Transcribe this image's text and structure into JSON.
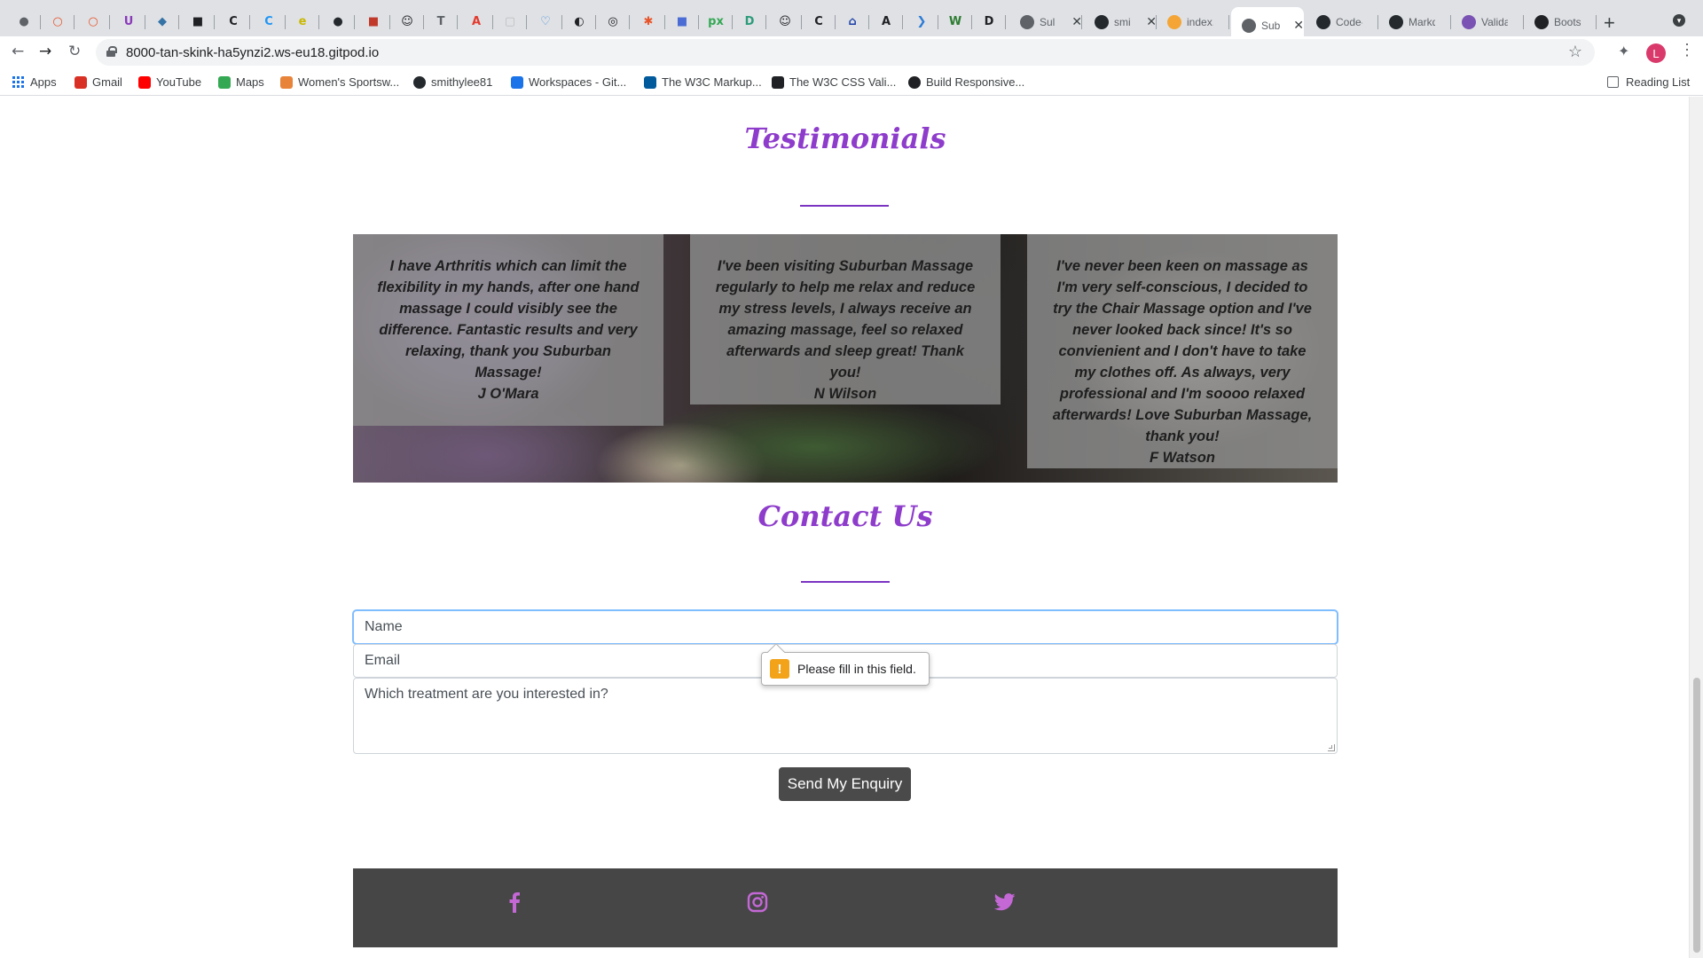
{
  "browser": {
    "tabs_small": [
      {
        "icon": "bulb-icon",
        "glyph": "●",
        "color": "#5f6368"
      },
      {
        "icon": "ring-icon",
        "glyph": "○",
        "color": "#e8542a"
      },
      {
        "icon": "ring-icon",
        "glyph": "○",
        "color": "#e8542a"
      },
      {
        "icon": "u-icon",
        "glyph": "U",
        "color": "#8a3ab9"
      },
      {
        "icon": "python-icon",
        "glyph": "◆",
        "color": "#3572a5"
      },
      {
        "icon": "bucket-icon",
        "glyph": "■",
        "color": "#202124"
      },
      {
        "icon": "c-black-icon",
        "glyph": "C",
        "color": "#202124"
      },
      {
        "icon": "c-blue-icon",
        "glyph": "C",
        "color": "#2196f3"
      },
      {
        "icon": "e-icon",
        "glyph": "e",
        "color": "#c9b800"
      },
      {
        "icon": "github-icon",
        "glyph": "●",
        "color": "#24292e"
      },
      {
        "icon": "red-square-icon",
        "glyph": "■",
        "color": "#c0392b"
      },
      {
        "icon": "face-icon",
        "glyph": "☺",
        "color": "#202124"
      },
      {
        "icon": "t-icon",
        "glyph": "T",
        "color": "#5f6368"
      },
      {
        "icon": "acrobat-icon",
        "glyph": "A",
        "color": "#e23a2e"
      },
      {
        "icon": "grey-icon",
        "glyph": "▢",
        "color": "#bdbdbd"
      },
      {
        "icon": "heart-icon",
        "glyph": "♡",
        "color": "#4a90d9"
      },
      {
        "icon": "globe-icon",
        "glyph": "◐",
        "color": "#202124"
      },
      {
        "icon": "target-icon",
        "glyph": "◎",
        "color": "#202124"
      },
      {
        "icon": "asterisk-icon",
        "glyph": "✱",
        "color": "#e8542a"
      },
      {
        "icon": "blocks-icon",
        "glyph": "■",
        "color": "#4a6cd4"
      },
      {
        "icon": "px-icon",
        "glyph": "px",
        "color": "#34a853"
      },
      {
        "icon": "d-icon",
        "glyph": "D",
        "color": "#2d9c7a"
      },
      {
        "icon": "smile-icon",
        "glyph": "☺",
        "color": "#202124"
      },
      {
        "icon": "c-dark-icon",
        "glyph": "C",
        "color": "#202124"
      },
      {
        "icon": "house-icon",
        "glyph": "⌂",
        "color": "#1a3ea8"
      },
      {
        "icon": "a-dark-icon",
        "glyph": "A",
        "color": "#202124"
      },
      {
        "icon": "vscode-icon",
        "glyph": "❯",
        "color": "#2b7bd6"
      },
      {
        "icon": "w-icon",
        "glyph": "W",
        "color": "#2e7d32"
      },
      {
        "icon": "d-square-icon",
        "glyph": "D",
        "color": "#202124"
      }
    ],
    "tabs_wide": [
      {
        "icon": "globe-icon",
        "title": "Sul",
        "close": true,
        "active": false,
        "color": "#5f6368"
      },
      {
        "icon": "github-icon",
        "title": "smi",
        "close": true,
        "active": false,
        "color": "#24292e"
      },
      {
        "icon": "g-icon",
        "title": "index.h",
        "close": false,
        "active": false,
        "color": "#f4a536"
      },
      {
        "icon": "globe-icon",
        "title": "Sub",
        "close": true,
        "active": true,
        "color": "#5f6368"
      },
      {
        "icon": "github-icon",
        "title": "Code-I",
        "close": false,
        "active": false,
        "color": "#24292e"
      },
      {
        "icon": "github-icon",
        "title": "Markdo",
        "close": false,
        "active": false,
        "color": "#24292e"
      },
      {
        "icon": "bootstrap-icon",
        "title": "Validat",
        "close": false,
        "active": false,
        "color": "#7952b3"
      },
      {
        "icon": "c-dark-icon",
        "title": "Bootstr",
        "close": false,
        "active": false,
        "color": "#202124"
      }
    ],
    "url": "8000-tan-skink-ha5ynzi2.ws-eu18.gitpod.io",
    "profile_initial": "L",
    "bookmarks": [
      {
        "name": "apps",
        "label": "Apps",
        "icon": "apps-grid-icon",
        "color": "#1a73e8"
      },
      {
        "name": "gmail",
        "label": "Gmail",
        "icon": "gmail-icon",
        "color": "#d93025"
      },
      {
        "name": "youtube",
        "label": "YouTube",
        "icon": "youtube-icon",
        "color": "#ff0000"
      },
      {
        "name": "maps",
        "label": "Maps",
        "icon": "maps-icon",
        "color": "#34a853"
      },
      {
        "name": "womens-sportswear",
        "label": "Women's Sportsw...",
        "icon": "store-icon",
        "color": "#e8833a"
      },
      {
        "name": "smithylee81",
        "label": "smithylee81",
        "icon": "github-icon",
        "color": "#24292e"
      },
      {
        "name": "workspaces",
        "label": "Workspaces - Git...",
        "icon": "gitpod-icon",
        "color": "#1a73e8"
      },
      {
        "name": "w3c-markup",
        "label": "The W3C Markup...",
        "icon": "w3c-icon",
        "color": "#005a9c"
      },
      {
        "name": "w3c-css",
        "label": "The W3C CSS Vali...",
        "icon": "w3c-css-icon",
        "color": "#202124"
      },
      {
        "name": "build-responsive",
        "label": "Build Responsive...",
        "icon": "globe-icon",
        "color": "#202124"
      }
    ],
    "reading_list": "Reading List"
  },
  "page": {
    "testimonials_title": "Testimonials",
    "testimonials": [
      {
        "text": "I have Arthritis which can limit the flexibility in my hands, after one hand massage I could visibly see the difference. Fantastic results and very relaxing, thank you Suburban Massage!",
        "author": "J O'Mara"
      },
      {
        "text": "I've been visiting Suburban Massage regularly to help me relax and reduce my stress levels, I always receive an amazing massage, feel so relaxed afterwards and sleep great! Thank you!",
        "author": "N Wilson"
      },
      {
        "text": "I've never been keen on massage as I'm very self-conscious, I decided to try the Chair Massage option and I've never looked back since! It's so convienient and I don't have to take my clothes off. As always, very professional and I'm soooo relaxed afterwards! Love Suburban Massage, thank you!",
        "author": "F Watson"
      }
    ],
    "contact_title": "Contact Us",
    "form": {
      "name_placeholder": "Name",
      "email_placeholder": "Email",
      "treatment_placeholder": "Which treatment are you interested in?",
      "submit_label": "Send My Enquiry",
      "validation_message": "Please fill in this field."
    },
    "social": [
      {
        "name": "facebook",
        "icon": "facebook-icon"
      },
      {
        "name": "instagram",
        "icon": "instagram-icon"
      },
      {
        "name": "twitter",
        "icon": "twitter-icon"
      }
    ],
    "colors": {
      "accent": "#8e3ccb",
      "social_icon": "#c468d6",
      "footer_bg": "#464646",
      "button_bg": "#4a4a4a"
    }
  }
}
